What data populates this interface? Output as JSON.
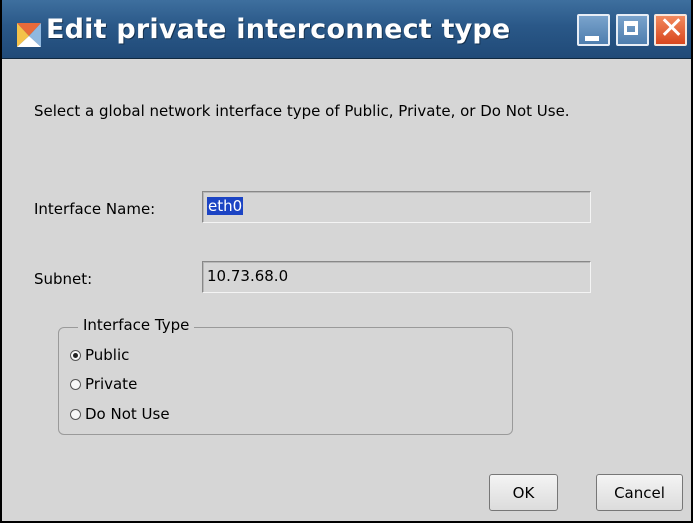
{
  "window": {
    "title": "Edit private interconnect type",
    "icon": "x-logo-icon",
    "controls": [
      "minimize-icon",
      "maximize-icon",
      "close-icon"
    ]
  },
  "description": "Select a global network interface type of Public, Private, or Do Not Use.",
  "interface_name": {
    "label": "Interface Name:",
    "value": "eth0",
    "value_selected": true
  },
  "subnet": {
    "label": "Subnet:",
    "value": "10.73.68.0"
  },
  "interface_type": {
    "title": "Interface Type",
    "options": [
      {
        "label": "Public",
        "checked": true
      },
      {
        "label": "Private",
        "checked": false
      },
      {
        "label": "Do Not Use",
        "checked": false
      }
    ]
  },
  "buttons": {
    "ok": "OK",
    "cancel": "Cancel"
  },
  "colors": {
    "titlebar": "#2a5888",
    "dialog_bg": "#d6d6d6",
    "selection": "#1c44c4",
    "close_button": "#d8461e"
  }
}
